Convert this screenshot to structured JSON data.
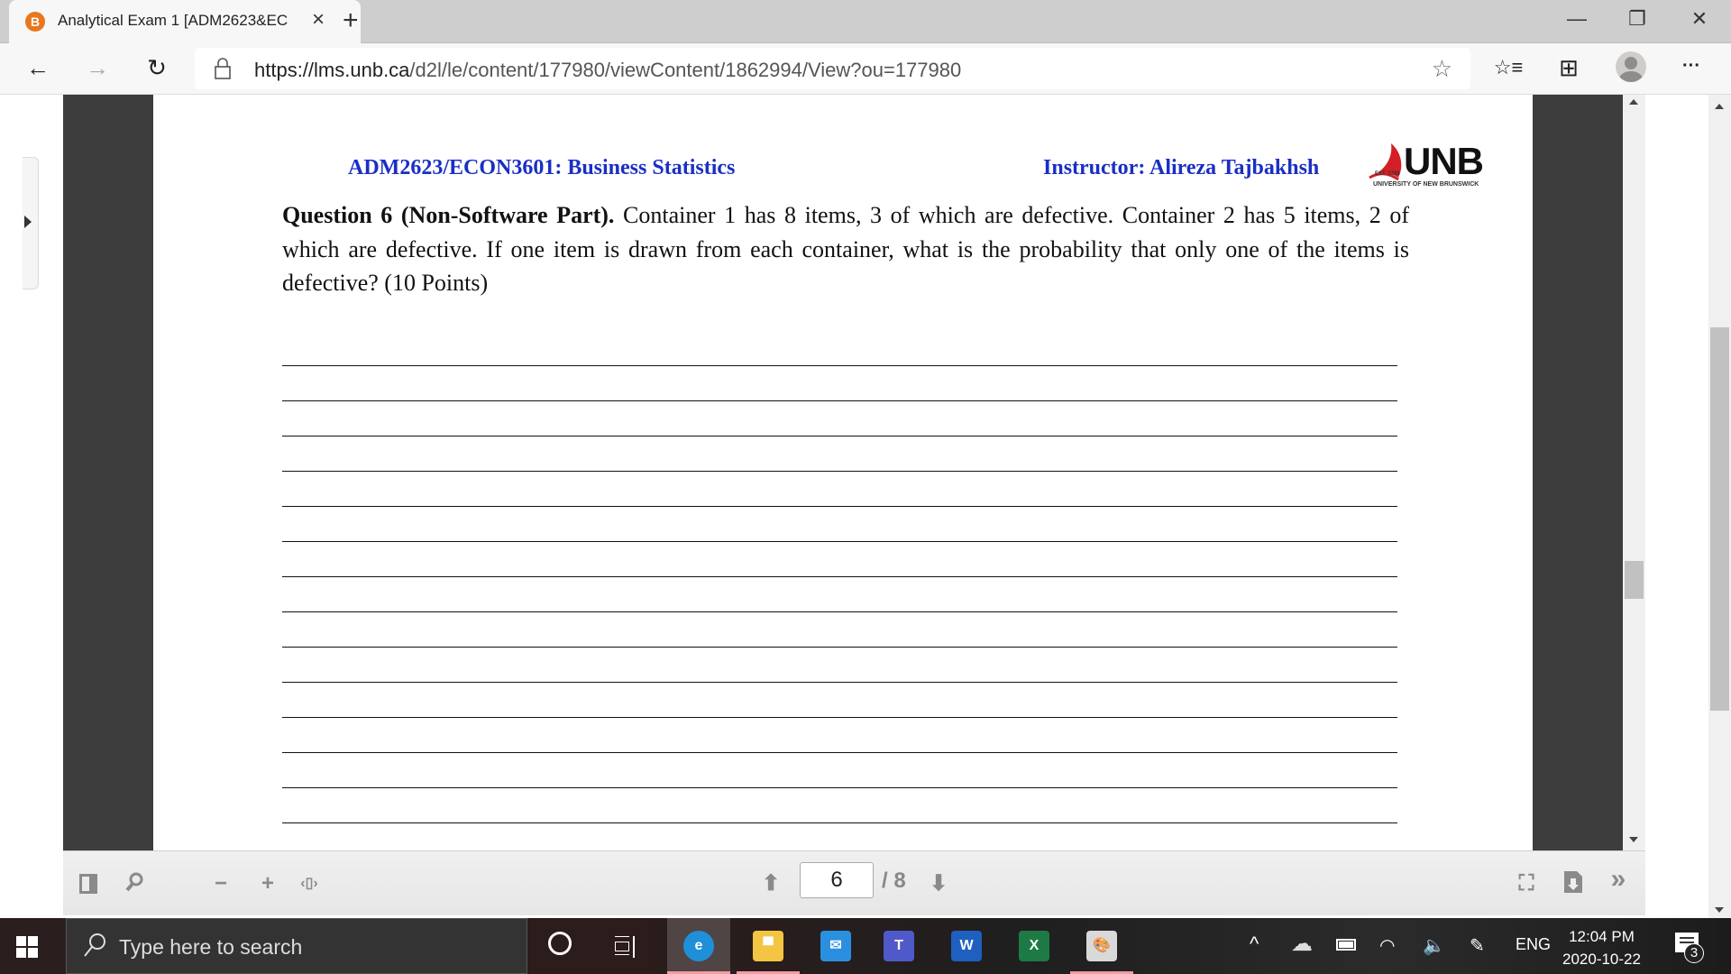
{
  "browser": {
    "tab": {
      "title": "Analytical Exam 1 [ADM2623&EC",
      "favicon_letter": "B",
      "close_icon": "×",
      "new_tab_icon": "+"
    },
    "window_controls": {
      "minimize": "—",
      "restore": "❐",
      "close": "✕"
    },
    "nav": {
      "back": "←",
      "forward": "→",
      "refresh": "↻"
    },
    "url_host": "https://lms.unb.ca",
    "url_path": "/d2l/le/content/177980/viewContent/1862994/View?ou=177980",
    "favorite_icon": "☆",
    "favorites_icon": "☆≡",
    "collections_icon": "⊞",
    "profile_icon": "●",
    "more_icon": "···"
  },
  "document": {
    "course_title": "ADM2623/ECON3601: Business Statistics",
    "instructor": "Instructor: Alireza Tajbakhsh",
    "logo": {
      "wordmark": "UNB",
      "est": "EST. 1785",
      "subtitle": "UNIVERSITY OF NEW BRUNSWICK"
    },
    "question_label": "Question 6 (Non-Software Part).",
    "question_text": " Container 1 has 8 items, 3 of which are defective. Container 2 has 5 items, 2 of which are defective. If one item is drawn from each container, what is the probability that only one of the items is defective? (10 Points)",
    "answer_line_count": 15
  },
  "viewer_toolbar": {
    "sidebar_icon": "▮",
    "search_icon": "⚲",
    "zoom_out": "−",
    "zoom_in": "+",
    "fit_icon": "‹▯›",
    "prev_page_icon": "⬆",
    "current_page": "6",
    "total_pages": "/ 8",
    "next_page_icon": "⬇",
    "fullscreen_icon": "⛶",
    "download_icon": "⬇",
    "more_icon": "»"
  },
  "taskbar": {
    "search_placeholder": "Type here to search",
    "cortana_icon": "○",
    "taskview_icon": "▯",
    "apps": [
      {
        "name": "edge",
        "label": "e",
        "color": "#1e8fd8",
        "active": true,
        "running": true
      },
      {
        "name": "file-explorer",
        "label": "▀",
        "color": "#f4c542",
        "active": false,
        "running": true
      },
      {
        "name": "mail",
        "label": "✉",
        "color": "#2b8fe0",
        "active": false,
        "running": false
      },
      {
        "name": "teams",
        "label": "T",
        "color": "#5059c9",
        "active": false,
        "running": false
      },
      {
        "name": "word",
        "label": "W",
        "color": "#1f5fbf",
        "active": false,
        "running": false
      },
      {
        "name": "excel",
        "label": "X",
        "color": "#1e7a45",
        "active": false,
        "running": false
      },
      {
        "name": "paint",
        "label": "🎨",
        "color": "#d9d9d9",
        "active": false,
        "running": true
      }
    ],
    "tray": {
      "chevron": "^",
      "onedrive": "☁",
      "battery": "▭",
      "wifi": "◠",
      "volume": "🔈",
      "pen": "✎",
      "language": "ENG"
    },
    "time": "12:04 PM",
    "date": "2020-10-22",
    "notification_count": "3"
  }
}
